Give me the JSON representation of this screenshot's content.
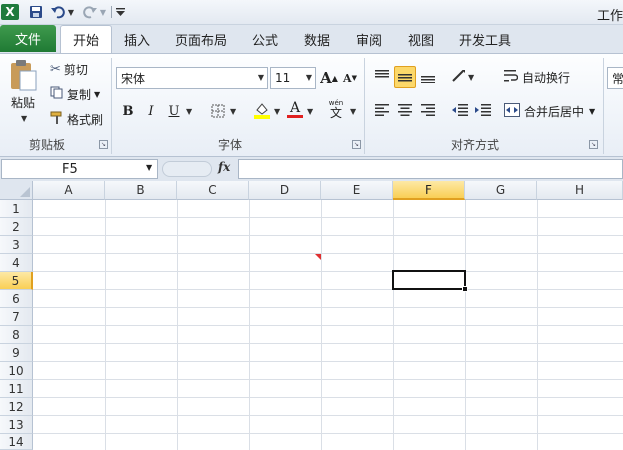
{
  "title_bar": {
    "app_icon_label": "X",
    "window_title": "工作"
  },
  "tabs": {
    "file": "文件",
    "items": [
      "开始",
      "插入",
      "页面布局",
      "公式",
      "数据",
      "审阅",
      "视图",
      "开发工具"
    ]
  },
  "ribbon": {
    "clipboard": {
      "paste": "粘贴",
      "cut": "剪切",
      "copy": "复制",
      "format_painter": "格式刷",
      "group_label": "剪贴板"
    },
    "font": {
      "font_name": "宋体",
      "font_size": "11",
      "group_label": "字体",
      "bold": "B",
      "italic": "I",
      "underline": "U",
      "font_color_glyph": "A",
      "phonetic": "wén",
      "phonetic_char": "文",
      "grow_font": "A",
      "shrink_font": "A"
    },
    "alignment": {
      "wrap_text": "自动换行",
      "merge_center": "合并后居中",
      "group_label": "对齐方式"
    },
    "number": {
      "format_value": "常"
    }
  },
  "formula_bar": {
    "name_box": "F5",
    "fx": "fx",
    "formula": ""
  },
  "sheet": {
    "columns": [
      "A",
      "B",
      "C",
      "D",
      "E",
      "F",
      "G",
      "H"
    ],
    "rows": [
      "1",
      "2",
      "3",
      "4",
      "5",
      "6",
      "7",
      "8",
      "9",
      "10",
      "11",
      "12",
      "13",
      "14"
    ],
    "selected_column": "F",
    "selected_row": "5"
  },
  "colors": {
    "file_tab": "#1f7a34",
    "selected_header": "#f9cf55",
    "comment_marker": "#e03030",
    "highlight_yellow": "#ffff00",
    "font_color_red": "#e02020"
  }
}
